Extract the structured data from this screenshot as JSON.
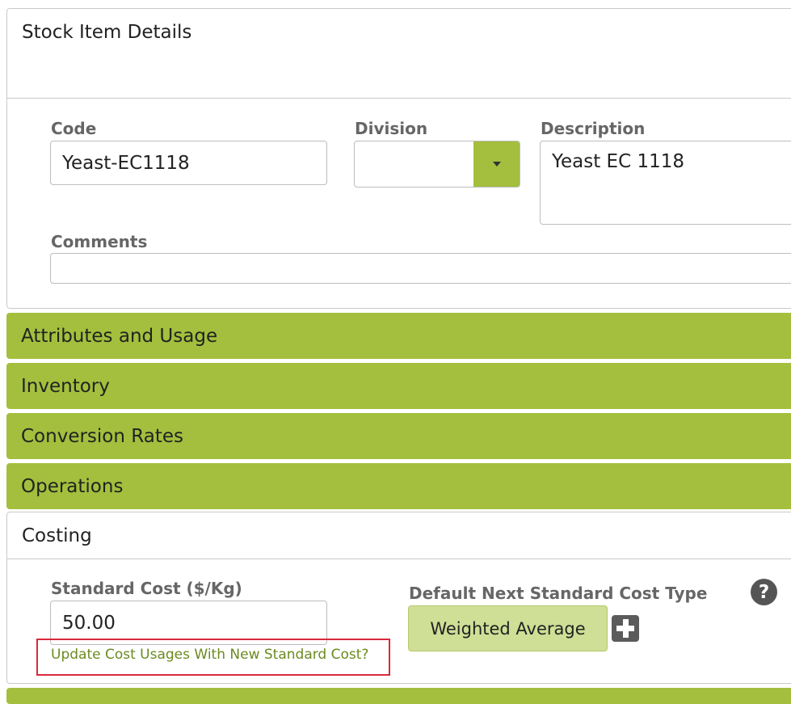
{
  "stock_item_panel": {
    "title": "Stock Item Details",
    "code": {
      "label": "Code",
      "value": "Yeast-EC1118"
    },
    "division": {
      "label": "Division",
      "value": ""
    },
    "description": {
      "label": "Description",
      "value": "Yeast EC 1118"
    },
    "comments": {
      "label": "Comments",
      "value": ""
    }
  },
  "sections": [
    {
      "label": "Attributes and Usage"
    },
    {
      "label": "Inventory"
    },
    {
      "label": "Conversion Rates"
    },
    {
      "label": "Operations"
    }
  ],
  "costing_panel": {
    "title": "Costing",
    "standard_cost": {
      "label": "Standard Cost ($/Kg)",
      "value": "50.00"
    },
    "update_link": "Update Cost Usages With New Standard Cost?",
    "default_next_type": {
      "label": "Default Next Standard Cost Type",
      "value": "Weighted Average"
    },
    "help_icon": "?"
  },
  "colors": {
    "accent_green": "#a3bf3d",
    "button_light_green": "#cfdf96",
    "highlight_red": "#d9293b",
    "link_green": "#6b8a1f"
  },
  "icons": {
    "dropdown": "caret-down-icon",
    "add": "plus-icon",
    "help": "question-circle-icon"
  }
}
